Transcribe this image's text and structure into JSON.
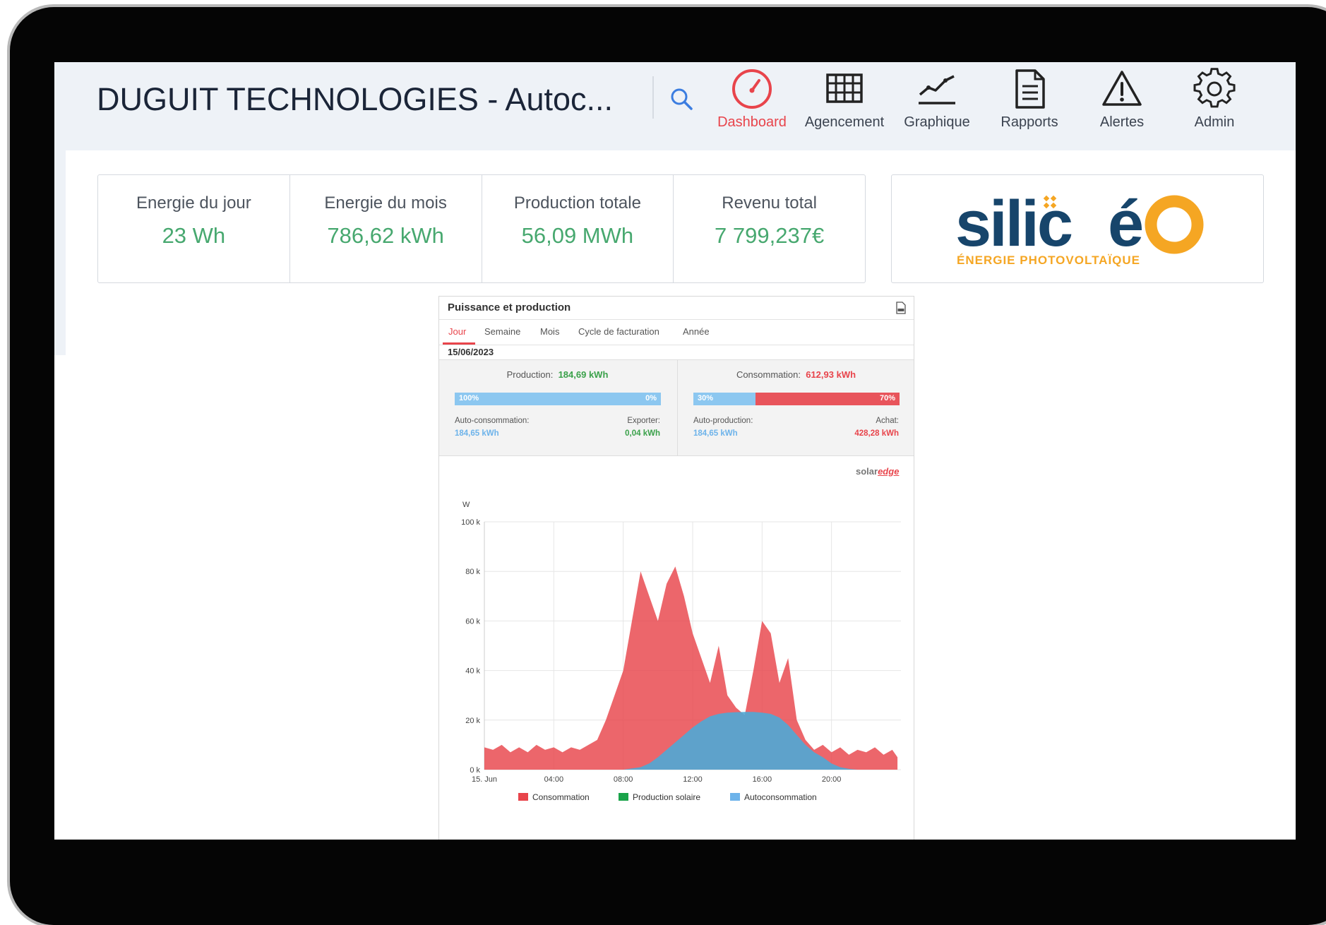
{
  "header": {
    "title": "DUGUIT TECHNOLOGIES - Autoc...",
    "nav": [
      {
        "label": "Dashboard",
        "icon": "speedometer-icon",
        "active": true
      },
      {
        "label": "Agencement",
        "icon": "grid-icon"
      },
      {
        "label": "Graphique",
        "icon": "line-chart-icon"
      },
      {
        "label": "Rapports",
        "icon": "document-icon"
      },
      {
        "label": "Alertes",
        "icon": "warning-icon"
      },
      {
        "label": "Admin",
        "icon": "gear-icon"
      }
    ]
  },
  "kpis": [
    {
      "label": "Energie du jour",
      "value": "23 Wh"
    },
    {
      "label": "Energie du mois",
      "value": "786,62 kWh"
    },
    {
      "label": "Production totale",
      "value": "56,09 MWh"
    },
    {
      "label": "Revenu total",
      "value": "7 799,237€"
    }
  ],
  "logo": {
    "brand": "silicéO",
    "tagline": "ÉNERGIE PHOTOVOLTAÏQUE"
  },
  "widget": {
    "title": "Puissance et production",
    "tabs": [
      "Jour",
      "Semaine",
      "Mois",
      "Cycle de facturation",
      "Année"
    ],
    "active_tab": "Jour",
    "date": "15/06/2023",
    "production": {
      "label": "Production:",
      "value": "184,69 kWh",
      "bar_left_label": "100%",
      "bar_right_label": "0%",
      "fill_fraction": 1.0,
      "left_sub_label": "Auto-consommation:",
      "left_sub_value": "184,65 kWh",
      "right_sub_label": "Exporter:",
      "right_sub_value": "0,04 kWh"
    },
    "consumption": {
      "label": "Consommation:",
      "value": "612,93 kWh",
      "bar_left_label": "30%",
      "bar_right_label": "70%",
      "fill_fraction": 0.3,
      "left_sub_label": "Auto-production:",
      "left_sub_value": "184,65 kWh",
      "right_sub_label": "Achat:",
      "right_sub_value": "428,28 kWh"
    },
    "brand": {
      "prefix": "solar",
      "suffix": "edge"
    }
  },
  "colors": {
    "accent": "#e8444b",
    "consumption": "#e8444b",
    "production": "#1aa34a",
    "autoconsumption": "#4fa8d6",
    "kpi_value": "#47a86f"
  },
  "chart_data": {
    "type": "area",
    "ylabel": "W",
    "y_ticks": [
      "0 k",
      "20 k",
      "40 k",
      "60 k",
      "80 k",
      "100 k"
    ],
    "ylim": [
      0,
      100000
    ],
    "x_ticks": [
      "15. Jun",
      "04:00",
      "08:00",
      "12:00",
      "16:00",
      "20:00"
    ],
    "x_hours": [
      0,
      0.5,
      1,
      1.5,
      2,
      2.5,
      3,
      3.5,
      4,
      4.5,
      5,
      5.5,
      6,
      6.5,
      7,
      7.5,
      8,
      8.5,
      9,
      9.5,
      10,
      10.5,
      11,
      11.5,
      12,
      12.5,
      13,
      13.5,
      14,
      14.5,
      15,
      15.5,
      16,
      16.5,
      17,
      17.5,
      18,
      18.5,
      19,
      19.5,
      20,
      20.5,
      21,
      21.5,
      22,
      22.5,
      23,
      23.5,
      23.8
    ],
    "series": [
      {
        "name": "Consommation",
        "values": [
          9000,
          8000,
          10000,
          7000,
          9000,
          7000,
          10000,
          8000,
          9000,
          7000,
          9000,
          8000,
          10000,
          12000,
          20000,
          30000,
          40000,
          60000,
          80000,
          70000,
          60000,
          75000,
          82000,
          70000,
          55000,
          45000,
          35000,
          50000,
          30000,
          25000,
          22000,
          40000,
          60000,
          55000,
          35000,
          45000,
          20000,
          12000,
          8000,
          10000,
          7000,
          9000,
          6000,
          8000,
          7000,
          9000,
          6000,
          8000,
          5000
        ]
      },
      {
        "name": "Production solaire",
        "values": [
          0,
          0,
          0,
          0,
          0,
          0,
          0,
          0,
          0,
          0,
          0,
          0,
          0,
          0,
          0,
          0,
          0,
          0,
          0,
          0,
          0,
          0,
          0,
          0,
          0,
          0,
          0,
          0,
          0,
          0,
          0,
          0,
          0,
          0,
          0,
          0,
          0,
          0,
          0,
          0,
          0,
          0,
          0,
          0,
          0,
          0,
          0,
          0,
          0
        ]
      },
      {
        "name": "Autoconsommation",
        "values": [
          0,
          0,
          0,
          0,
          0,
          0,
          0,
          0,
          0,
          0,
          0,
          0,
          0,
          0,
          0,
          0,
          0,
          500,
          1000,
          2500,
          5000,
          8000,
          11000,
          14000,
          17000,
          19500,
          21500,
          22500,
          23000,
          23200,
          23300,
          23300,
          23000,
          22500,
          21000,
          18000,
          14000,
          10000,
          7000,
          5000,
          2500,
          1000,
          300,
          0,
          0,
          0,
          0,
          0,
          0
        ]
      }
    ],
    "legend": [
      "Consommation",
      "Production solaire",
      "Autoconsommation"
    ],
    "legend_position": "bottom",
    "grid": true
  }
}
